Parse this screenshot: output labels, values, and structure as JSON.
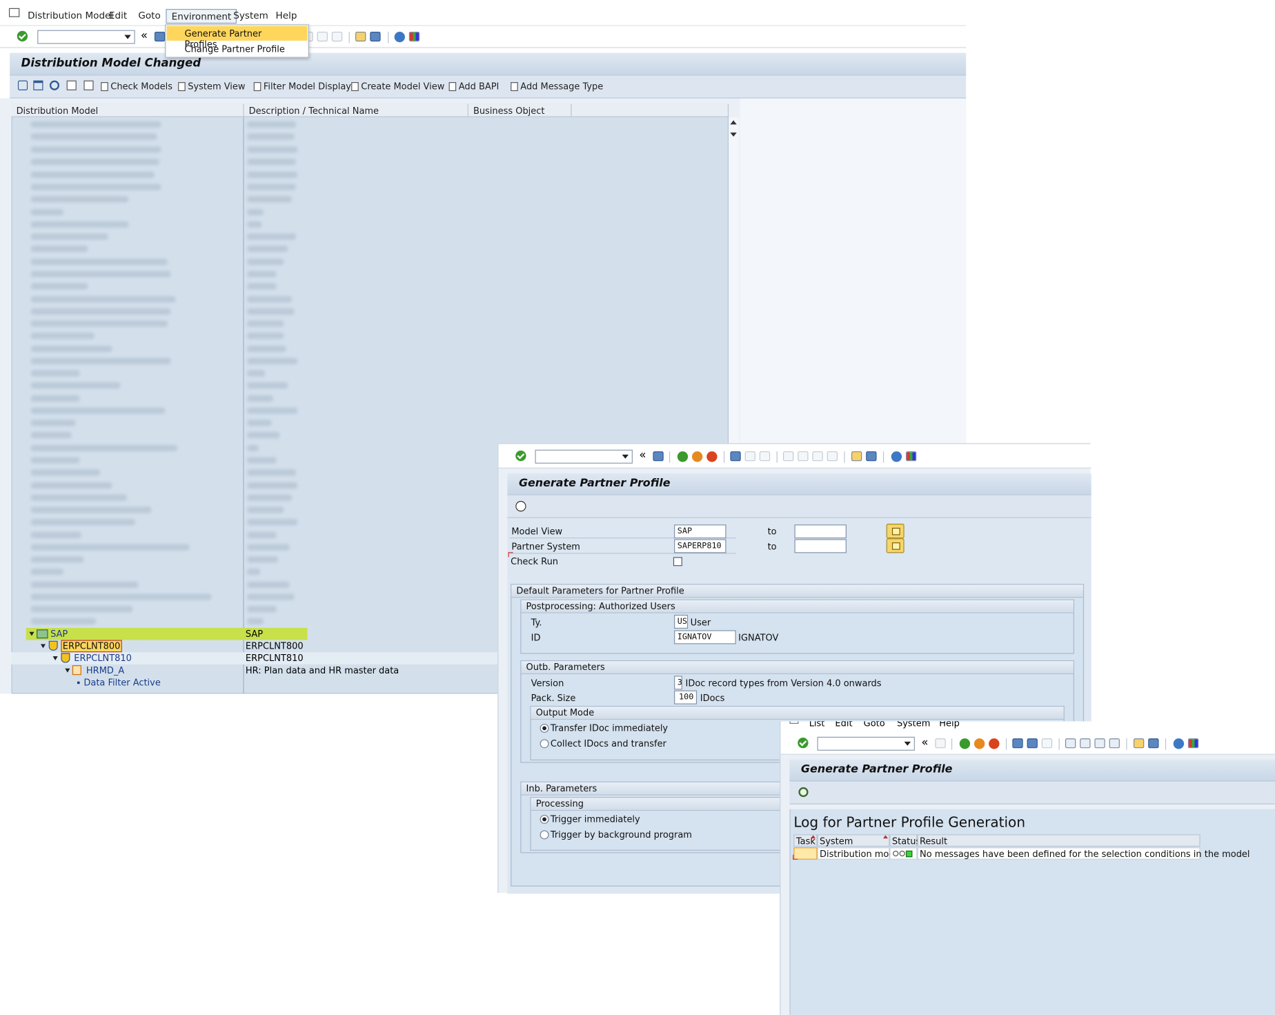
{
  "menubar": {
    "items": [
      {
        "label": "Distribution Model"
      },
      {
        "label": "Edit"
      },
      {
        "label": "Goto"
      },
      {
        "label": "Environment"
      },
      {
        "label": "System"
      },
      {
        "label": "Help"
      }
    ]
  },
  "environment_menu": {
    "items": [
      {
        "label": "Generate Partner Profiles"
      },
      {
        "label": "Change Partner Profile"
      }
    ]
  },
  "toolbar": {
    "back_label": "«"
  },
  "main": {
    "title": "Distribution Model Changed",
    "app_buttons": [
      {
        "label": "Check Models"
      },
      {
        "label": "System View"
      },
      {
        "label": "Filter Model Display"
      },
      {
        "label": "Create Model View"
      },
      {
        "label": "Add BAPI"
      },
      {
        "label": "Add Message Type"
      }
    ],
    "columns": [
      "Distribution Model",
      "Description / Technical Name",
      "Business Object"
    ],
    "tree": [
      {
        "name": "SAP",
        "desc": "SAP"
      },
      {
        "name": "ERPCLNT800",
        "desc": "ERPCLNT800"
      },
      {
        "name": "ERPCLNT810",
        "desc": "ERPCLNT810"
      },
      {
        "name": "HRMD_A",
        "desc": "HR: Plan data and HR master data"
      },
      {
        "name": "Data Filter Active",
        "desc": ""
      }
    ]
  },
  "gen_dialog": {
    "title": "Generate Partner Profile",
    "fields": {
      "model_view_label": "Model View",
      "model_view_value": "SAP",
      "partner_system_label": "Partner System",
      "partner_system_value": "SAPERP810",
      "to_label": "to",
      "check_run_label": "Check Run"
    },
    "default_params_title": "Default Parameters for Partner Profile",
    "postprocessing": {
      "title": "Postprocessing: Authorized Users",
      "type_label": "Ty.",
      "type_value": "US",
      "type_text": "User",
      "id_label": "ID",
      "id_value": "IGNATOV",
      "id_text": "IGNATOV"
    },
    "outbound": {
      "title": "Outb. Parameters",
      "version_label": "Version",
      "version_value": "3",
      "version_text": "IDoc record types from Version 4.0 onwards",
      "pack_label": "Pack. Size",
      "pack_value": "100",
      "pack_text": "IDocs",
      "output_mode_title": "Output Mode",
      "opt1": "Transfer IDoc immediately",
      "opt2": "Collect IDocs and transfer"
    },
    "inbound": {
      "title": "Inb. Parameters",
      "processing_title": "Processing",
      "opt1": "Trigger immediately",
      "opt2": "Trigger by background program"
    }
  },
  "log_window": {
    "menubar": [
      "List",
      "Edit",
      "Goto",
      "System",
      "Help"
    ],
    "title": "Generate Partner Profile",
    "heading": "Log for Partner Profile Generation",
    "columns": [
      "Task",
      "System",
      "Status",
      "Result"
    ],
    "rows": [
      {
        "task": "",
        "system": "Distribution model",
        "result": "No messages have been defined for the selection conditions in the model"
      }
    ]
  },
  "colors": {
    "highlight": "#c8e04a",
    "menu_selected": "#ffd65c",
    "sap_bg": "#dce7f2"
  }
}
